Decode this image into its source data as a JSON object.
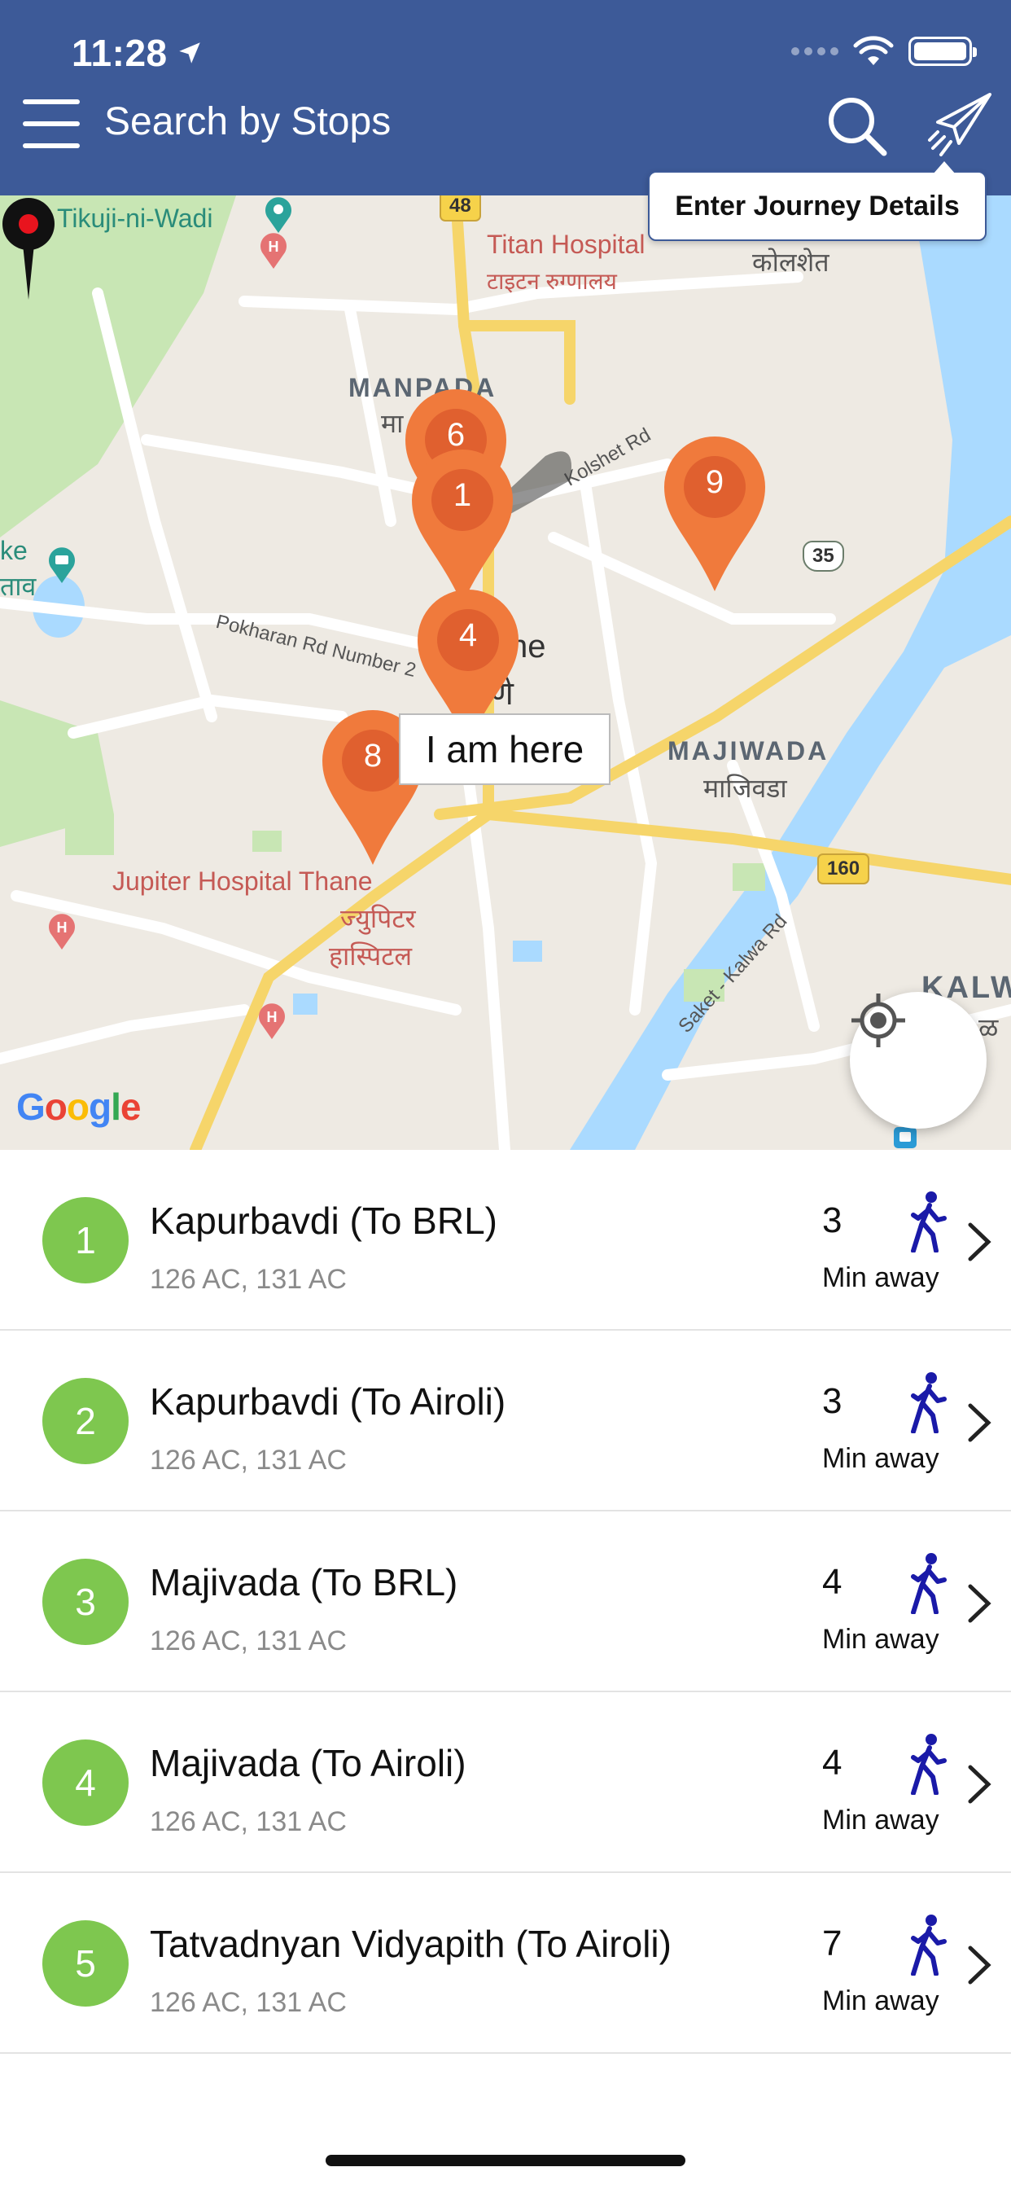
{
  "status_bar": {
    "time": "11:28"
  },
  "header": {
    "title": "Search by Stops",
    "tooltip": "Enter Journey Details",
    "bg_color": "#3d5a98"
  },
  "map": {
    "labels": {
      "tikuji": "Tikuji-ni-Wadi",
      "titan_en": "Titan Hospital",
      "titan_mr": "टाइटन रुग्णालय",
      "kolshet_mr": "कोलशेत",
      "manpada": "MANPADA",
      "manpada_mr": "मा",
      "kolshet_rd": "Kolshet Rd",
      "pokharan_rd": "Pokharan Rd Number 2",
      "majiwada": "MAJIWADA",
      "majiwada_mr": "माजिवडा",
      "jupiter_en": "Jupiter Hospital Thane",
      "jupiter_mr1": "ज्युपिटर",
      "jupiter_mr2": "हास्पिटल",
      "saket_rd": "Saket - Kalwa Rd",
      "kalwa": "KALW",
      "kalwa_mr": "ळ",
      "lake_en": "ke",
      "lake_mr": "ताव",
      "thane_part": "ne",
      "thane_mr_part": "णे"
    },
    "shields": {
      "s48": "48",
      "s35": "35",
      "s160": "160"
    },
    "markers": [
      "6",
      "1",
      "9",
      "4",
      "8"
    ],
    "you_are_here": "I am here",
    "attribution": {
      "g1": "G",
      "o1": "o",
      "o2": "o",
      "g2": "g",
      "l": "l",
      "e": "e"
    }
  },
  "stops": [
    {
      "index": "1",
      "name": "Kapurbavdi (To BRL)",
      "routes": "126 AC, 131 AC",
      "minutes": "3",
      "unit": "Min away"
    },
    {
      "index": "2",
      "name": "Kapurbavdi (To Airoli)",
      "routes": "126 AC, 131 AC",
      "minutes": "3",
      "unit": "Min away"
    },
    {
      "index": "3",
      "name": "Majivada (To BRL)",
      "routes": "126 AC, 131 AC",
      "minutes": "4",
      "unit": "Min away"
    },
    {
      "index": "4",
      "name": "Majivada (To Airoli)",
      "routes": "126 AC, 131 AC",
      "minutes": "4",
      "unit": "Min away"
    },
    {
      "index": "5",
      "name": "Tatvadnyan Vidyapith (To Airoli)",
      "routes": "126 AC, 131 AC",
      "minutes": "7",
      "unit": "Min away"
    }
  ],
  "colors": {
    "badge": "#7ec74f",
    "marker": "#f07a3c",
    "walk_icon": "#1a1aa8",
    "water": "#aadaff",
    "park": "#c8e6b4"
  }
}
